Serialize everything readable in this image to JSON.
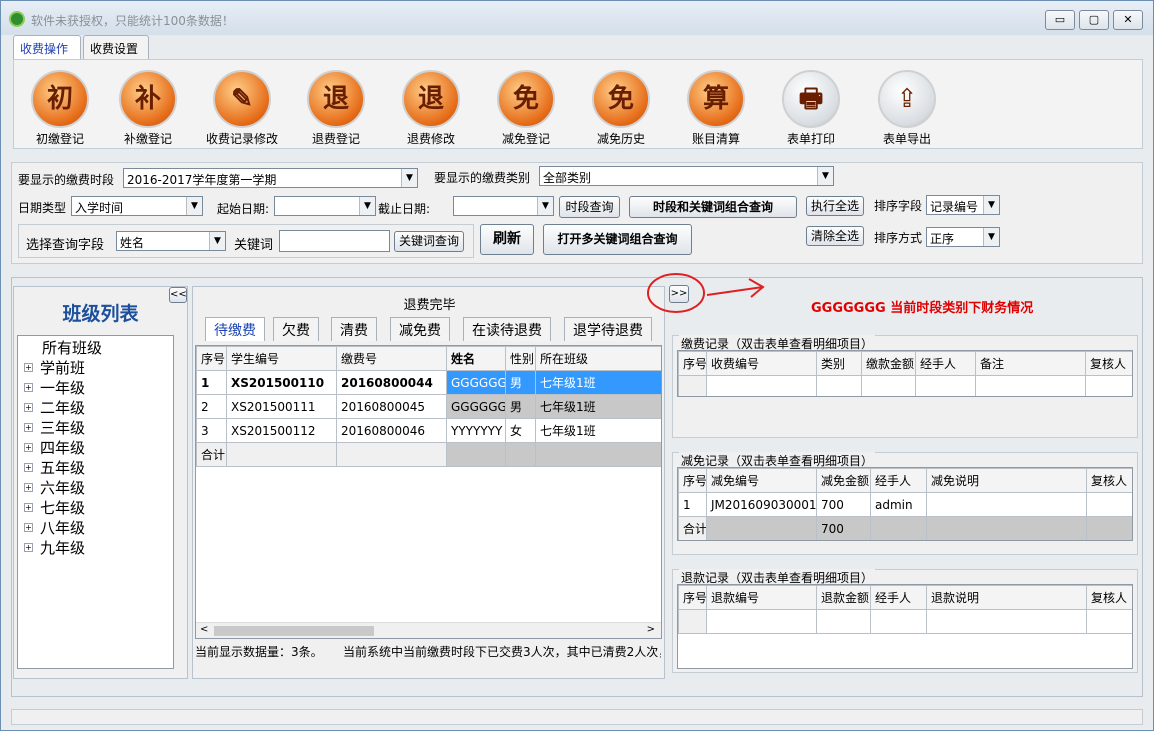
{
  "window": {
    "title": "软件未获授权，只能统计100条数据！",
    "min": "▭",
    "max": "▢",
    "close": "✕"
  },
  "tabs": [
    "收费操作",
    "收费设置"
  ],
  "ribbon": [
    {
      "label": "初缴登记",
      "glyph": "初",
      "icon": "initial-payment-icon"
    },
    {
      "label": "补缴登记",
      "glyph": "补",
      "icon": "supplementary-payment-icon"
    },
    {
      "label": "收费记录修改",
      "glyph": "✎",
      "icon": "edit-record-icon"
    },
    {
      "label": "退费登记",
      "glyph": "退",
      "icon": "refund-icon"
    },
    {
      "label": "退费修改",
      "glyph": "退",
      "icon": "refund-edit-icon"
    },
    {
      "label": "减免登记",
      "glyph": "免",
      "icon": "waiver-icon"
    },
    {
      "label": "减免历史",
      "glyph": "免",
      "icon": "waiver-history-icon"
    },
    {
      "label": "账目清算",
      "glyph": "算",
      "icon": "settlement-icon"
    },
    {
      "label": "表单打印",
      "glyph": "🖶",
      "icon": "printer-icon"
    },
    {
      "label": "表单导出",
      "glyph": "⇪",
      "icon": "export-icon"
    }
  ],
  "filter": {
    "period_label": "要显示的缴费时段",
    "period_value": "2016-2017学年度第一学期",
    "category_label": "要显示的缴费类别",
    "category_value": "全部类别",
    "datetype_label": "日期类型",
    "datetype_value": "入学时间",
    "start_label": "起始日期:",
    "end_label": "截止日期:",
    "period_query": "时段查询",
    "combo_query": "时段和关键词组合查询",
    "select_all": "执行全选",
    "clear_all": "清除全选",
    "sort_field_label": "排序字段",
    "sort_field_value": "记录编号",
    "sort_order_label": "排序方式",
    "sort_order_value": "正序",
    "query_field_label": "选择查询字段",
    "query_field_value": "姓名",
    "keyword_label": "关键词",
    "keyword_query": "关键词查询",
    "refresh": "刷新",
    "multi_query": "打开多关键词组合查询"
  },
  "classes": {
    "title": "班级列表",
    "collapse": "<<",
    "root": "所有班级",
    "items": [
      "学前班",
      "一年级",
      "二年级",
      "三年级",
      "四年级",
      "五年级",
      "六年级",
      "七年级",
      "八年级",
      "九年级"
    ]
  },
  "center": {
    "top_tab": "退费完毕",
    "tabs": [
      "待缴费",
      "欠费",
      "清费",
      "减免费",
      "在读待退费",
      "退学待退费"
    ],
    "headers": [
      "序号",
      "学生编号",
      "缴费号",
      "姓名",
      "性别",
      "所在班级"
    ],
    "rows": [
      [
        "1",
        "XS201500110",
        "20160800044",
        "GGGGGG",
        "男",
        "七年级1班"
      ],
      [
        "2",
        "XS201500111",
        "20160800045",
        "GGGGGG",
        "男",
        "七年级1班"
      ],
      [
        "3",
        "XS201500112",
        "20160800046",
        "YYYYYYY",
        "女",
        "七年级1班"
      ]
    ],
    "total_label": "合计",
    "status_count": "当前显示数据量：3条。",
    "status_summary": "当前系统中当前缴费时段下已交费3人次，其中已清费2人次，"
  },
  "right": {
    "expand": ">>",
    "annotation": "GGGGGGG 当前时段类别下财务情况",
    "payment": {
      "caption": "缴费记录（双击表单查看明细项目）",
      "headers": [
        "序号",
        "收费编号",
        "类别",
        "缴款金额",
        "经手人",
        "备注",
        "复核人"
      ]
    },
    "waiver": {
      "caption": "减免记录（双击表单查看明细项目）",
      "headers": [
        "序号",
        "减免编号",
        "减免金额",
        "经手人",
        "减免说明",
        "复核人"
      ],
      "row": [
        "1",
        "JM201609030001",
        "700",
        "admin",
        "",
        ""
      ],
      "total_label": "合计",
      "total_value": "700"
    },
    "refund": {
      "caption": "退款记录（双击表单查看明细项目）",
      "headers": [
        "序号",
        "退款编号",
        "退款金额",
        "经手人",
        "退款说明",
        "复核人"
      ]
    }
  }
}
